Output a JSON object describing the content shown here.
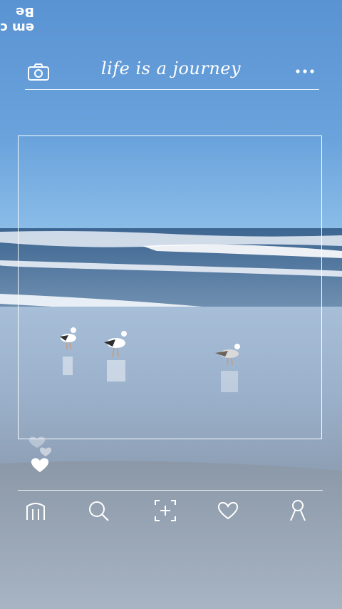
{
  "overlay_caption": {
    "line1": "em c",
    "line2": "Be"
  },
  "header": {
    "title": "life is a journey"
  },
  "icons": {
    "camera": "camera-icon",
    "more": "more-dots-icon",
    "hearts": "heart-icon",
    "home": "home-icon",
    "search": "search-icon",
    "add": "add-square-icon",
    "activity": "heart-outline-icon",
    "profile": "profile-icon"
  },
  "colors": {
    "sky": "#5f95d0",
    "sea": "#4a7396",
    "sand": "#8aa0b8",
    "line": "#ffffff"
  }
}
